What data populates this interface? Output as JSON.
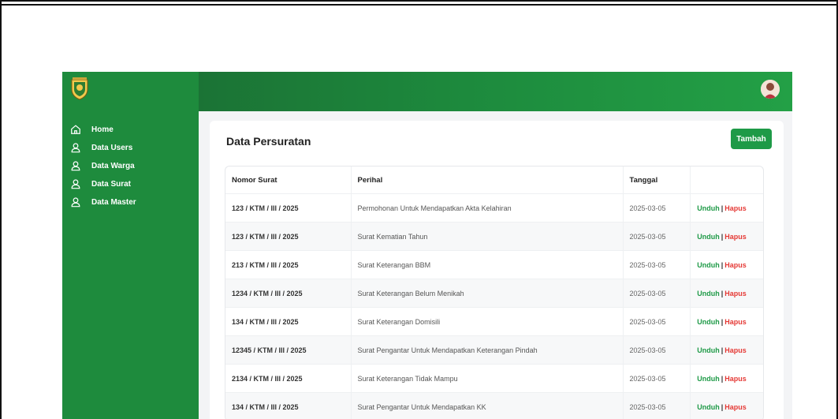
{
  "sidebar": {
    "items": [
      {
        "label": "Home",
        "icon": "home-icon"
      },
      {
        "label": "Data Users",
        "icon": "user-icon"
      },
      {
        "label": "Data Warga",
        "icon": "user-icon"
      },
      {
        "label": "Data Surat",
        "icon": "user-icon"
      },
      {
        "label": "Data Master",
        "icon": "user-icon"
      }
    ]
  },
  "main": {
    "title": "Data Persuratan",
    "add_label": "Tambah",
    "columns": [
      "Nomor Surat",
      "Perihal",
      "Tanggal",
      ""
    ],
    "action_download": "Unduh",
    "action_separator": "|",
    "action_delete": "Hapus",
    "rows": [
      {
        "nomor": "123 / KTM / III / 2025",
        "perihal": "Permohonan Untuk Mendapatkan Akta Kelahiran",
        "tanggal": "2025-03-05"
      },
      {
        "nomor": "123 / KTM / III / 2025",
        "perihal": "Surat Kematian Tahun",
        "tanggal": "2025-03-05"
      },
      {
        "nomor": "213 / KTM / III / 2025",
        "perihal": "Surat Keterangan BBM",
        "tanggal": "2025-03-05"
      },
      {
        "nomor": "1234 / KTM / III / 2025",
        "perihal": "Surat Keterangan Belum Menikah",
        "tanggal": "2025-03-05"
      },
      {
        "nomor": "134 / KTM / III / 2025",
        "perihal": "Surat Keterangan Domisili",
        "tanggal": "2025-03-05"
      },
      {
        "nomor": "12345 / KTM / III / 2025",
        "perihal": "Surat Pengantar Untuk Mendapatkan Keterangan Pindah",
        "tanggal": "2025-03-05"
      },
      {
        "nomor": "2134 / KTM / III / 2025",
        "perihal": "Surat Keterangan Tidak Mampu",
        "tanggal": "2025-03-05"
      },
      {
        "nomor": "134 / KTM / III / 2025",
        "perihal": "Surat Pengantar Untuk Mendapatkan KK",
        "tanggal": "2025-03-05"
      }
    ]
  },
  "colors": {
    "sidebar": "#1e8b3d",
    "accent": "#1e9a47",
    "danger": "#e53935"
  }
}
